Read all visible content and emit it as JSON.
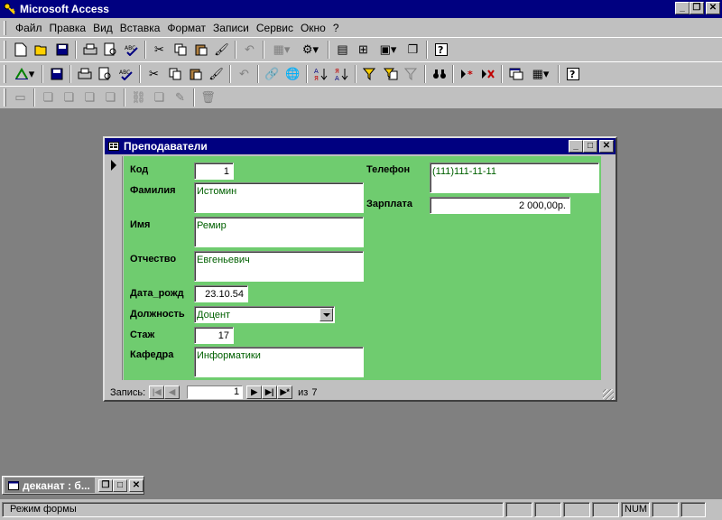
{
  "app": {
    "title": "Microsoft Access"
  },
  "menu": [
    "Файл",
    "Правка",
    "Вид",
    "Вставка",
    "Формат",
    "Записи",
    "Сервис",
    "Окно",
    "?"
  ],
  "form": {
    "title": "Преподаватели",
    "labels": {
      "kod": "Код",
      "familiya": "Фамилия",
      "imya": "Имя",
      "otchestvo": "Отчество",
      "data_rozhd": "Дата_рожд",
      "dolzhnost": "Должность",
      "stazh": "Стаж",
      "kafedra": "Кафедра",
      "telefon": "Телефон",
      "zarplata": "Зарплата"
    },
    "values": {
      "kod": "1",
      "familiya": "Истомин",
      "imya": "Ремир",
      "otchestvo": "Евгеньевич",
      "data_rozhd": "23.10.54",
      "dolzhnost": "Доцент",
      "stazh": "17",
      "kafedra": "Информатики",
      "telefon": "(111)111-11-11",
      "zarplata": "2 000,00р."
    }
  },
  "navigation": {
    "label": "Запись:",
    "current": "1",
    "of_text": "из",
    "total": "7"
  },
  "minimized_window": {
    "title": "деканат : б..."
  },
  "status": {
    "mode": "Режим формы",
    "num": "NUM"
  }
}
